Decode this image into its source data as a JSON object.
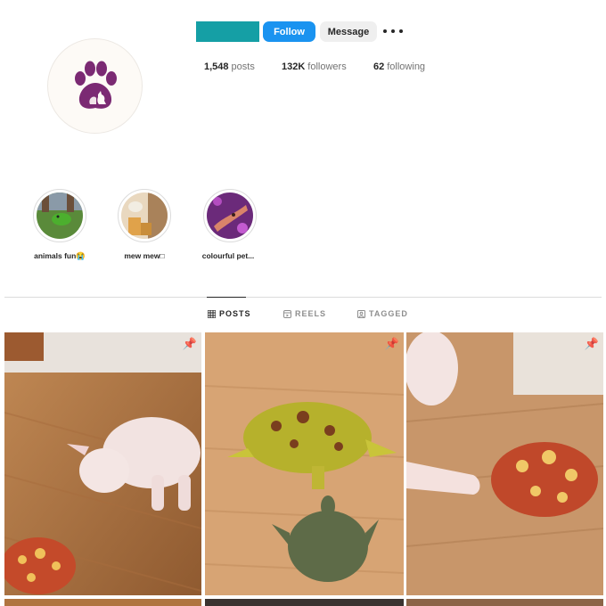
{
  "header": {
    "follow_label": "Follow",
    "message_label": "Message",
    "more_icon": "more-horizontal-icon",
    "name_color": "#159fa5"
  },
  "stats": {
    "posts_value": "1,548",
    "posts_label": "posts",
    "followers_value": "132K",
    "followers_label": "followers",
    "following_value": "62",
    "following_label": "following"
  },
  "highlights": [
    {
      "label": "animals fun😭"
    },
    {
      "label": "mew mew□"
    },
    {
      "label": "colourful pet..."
    }
  ],
  "tabs": [
    {
      "label": "POSTS",
      "icon": "grid-icon",
      "active": true
    },
    {
      "label": "REELS",
      "icon": "reels-icon",
      "active": false
    },
    {
      "label": "TAGGED",
      "icon": "tagged-icon",
      "active": false
    }
  ],
  "posts": [
    {
      "subject": "hairless cat with ornate horned frog",
      "pinned": true
    },
    {
      "subject": "ornate horned frog above a softshell turtle",
      "pinned": true
    },
    {
      "subject": "hand reaching toward an ornate horned frog",
      "pinned": true
    }
  ],
  "colors": {
    "follow_blue": "#1a93f0",
    "paw_purple": "#7b2a73"
  }
}
